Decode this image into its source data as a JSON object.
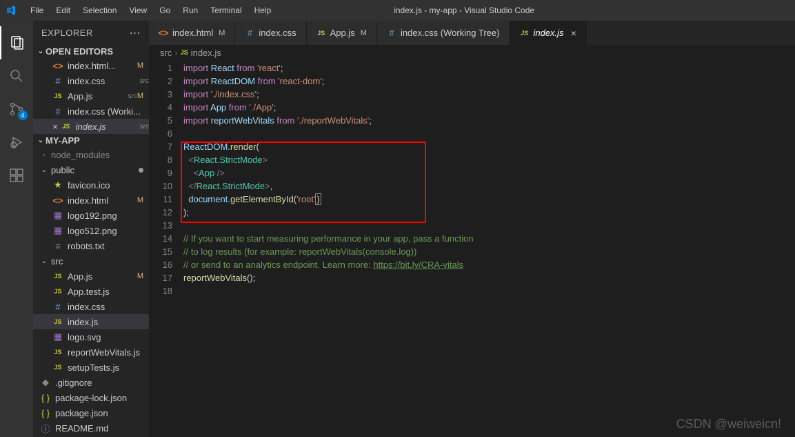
{
  "title": "index.js - my-app - Visual Studio Code",
  "menu": [
    "File",
    "Edit",
    "Selection",
    "View",
    "Go",
    "Run",
    "Terminal",
    "Help"
  ],
  "activity": {
    "scm_badge": "4"
  },
  "sidebar": {
    "title": "EXPLORER",
    "sections": {
      "openEditors": "OPEN EDITORS",
      "project": "MY-APP"
    },
    "openEditors": [
      {
        "icon": "html",
        "label": "index.html...",
        "suffix": "",
        "mod": "M"
      },
      {
        "icon": "css",
        "label": "index.css",
        "suffix": "src",
        "mod": ""
      },
      {
        "icon": "js",
        "label": "App.js",
        "suffix": "src",
        "mod": "M"
      },
      {
        "icon": "css",
        "label": "index.css (Worki...",
        "suffix": "",
        "mod": ""
      },
      {
        "icon": "js",
        "label": "index.js",
        "suffix": "src",
        "mod": "",
        "active": true,
        "close": true,
        "italic": true
      }
    ],
    "tree": [
      {
        "type": "folder",
        "chev": "›",
        "label": "node_modules",
        "color": "#888",
        "indent": 0
      },
      {
        "type": "folder",
        "chev": "⌄",
        "label": "public",
        "indent": 0,
        "dot": true
      },
      {
        "type": "file",
        "icon": "star",
        "label": "favicon.ico",
        "indent": 1
      },
      {
        "type": "file",
        "icon": "html",
        "label": "index.html",
        "indent": 1,
        "mod": "M"
      },
      {
        "type": "file",
        "icon": "img",
        "label": "logo192.png",
        "indent": 1
      },
      {
        "type": "file",
        "icon": "img",
        "label": "logo512.png",
        "indent": 1
      },
      {
        "type": "file",
        "icon": "txt",
        "label": "robots.txt",
        "indent": 1
      },
      {
        "type": "folder",
        "chev": "⌄",
        "label": "src",
        "indent": 0
      },
      {
        "type": "file",
        "icon": "js",
        "label": "App.js",
        "indent": 1,
        "mod": "M"
      },
      {
        "type": "file",
        "icon": "js",
        "label": "App.test.js",
        "indent": 1
      },
      {
        "type": "file",
        "icon": "css",
        "label": "index.css",
        "indent": 1
      },
      {
        "type": "file",
        "icon": "js",
        "label": "index.js",
        "indent": 1,
        "active": true
      },
      {
        "type": "file",
        "icon": "img",
        "label": "logo.svg",
        "indent": 1
      },
      {
        "type": "file",
        "icon": "js",
        "label": "reportWebVitals.js",
        "indent": 1
      },
      {
        "type": "file",
        "icon": "js",
        "label": "setupTests.js",
        "indent": 1
      },
      {
        "type": "file",
        "icon": "git",
        "label": ".gitignore",
        "indent": 0
      },
      {
        "type": "file",
        "icon": "json",
        "label": "package-lock.json",
        "indent": 0
      },
      {
        "type": "file",
        "icon": "json",
        "label": "package.json",
        "indent": 0
      },
      {
        "type": "file",
        "icon": "info",
        "label": "README.md",
        "indent": 0
      }
    ]
  },
  "tabs": [
    {
      "icon": "html",
      "label": "index.html",
      "mod": "M"
    },
    {
      "icon": "css",
      "label": "index.css",
      "mod": ""
    },
    {
      "icon": "js",
      "label": "App.js",
      "mod": "M"
    },
    {
      "icon": "css",
      "label": "index.css (Working Tree)",
      "mod": ""
    },
    {
      "icon": "js",
      "label": "index.js",
      "mod": "",
      "active": true,
      "italic": true,
      "close": true
    }
  ],
  "breadcrumb": {
    "p1": "src",
    "p2": "index.js"
  },
  "code": {
    "lines": 18,
    "l1": {
      "a": "import",
      "b": "React",
      "c": "from",
      "d": "'react'",
      "e": ";"
    },
    "l2": {
      "a": "import",
      "b": "ReactDOM",
      "c": "from",
      "d": "'react-dom'",
      "e": ";"
    },
    "l3": {
      "a": "import",
      "d": "'./index.css'",
      "e": ";"
    },
    "l4": {
      "a": "import",
      "b": "App",
      "c": "from",
      "d": "'./App'",
      "e": ";"
    },
    "l5": {
      "a": "import",
      "b": "reportWebVitals",
      "c": "from",
      "d": "'./reportWebVitals'",
      "e": ";"
    },
    "l7": {
      "a": "ReactDOM",
      "b": ".",
      "c": "render",
      "d": "("
    },
    "l8": {
      "a": "<",
      "b": "React.StrictMode",
      "c": ">"
    },
    "l9": {
      "a": "<",
      "b": "App",
      "c": " />"
    },
    "l10": {
      "a": "</",
      "b": "React.StrictMode",
      "c": ">",
      "d": ","
    },
    "l11": {
      "a": "document",
      "b": ".",
      "c": "getElementById",
      "d": "(",
      "e": "'root'",
      "f": ")"
    },
    "l12": {
      "a": ");"
    },
    "l14": "// If you want to start measuring performance in your app, pass a function",
    "l15": "// to log results (for example: reportWebVitals(console.log))",
    "l16a": "// or send to an analytics endpoint. Learn more: ",
    "l16b": "https://bit.ly/CRA-vitals",
    "l17": {
      "a": "reportWebVitals",
      "b": "();"
    }
  },
  "watermark": "CSDN @weiweicn!"
}
